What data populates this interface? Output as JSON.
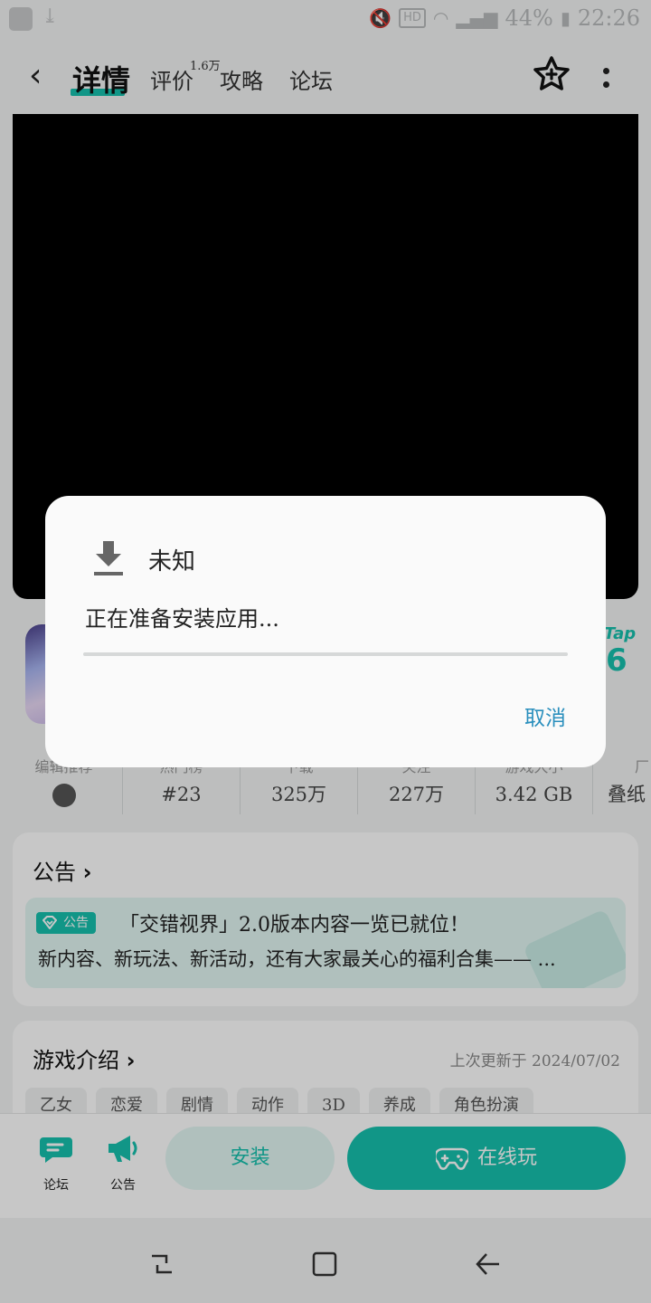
{
  "status_bar": {
    "download_icon": "download-arrow-icon",
    "hd_badge": "HD",
    "network": "4G",
    "battery": "44%",
    "time": "22:26"
  },
  "header": {
    "back_icon": "chevron-left-icon",
    "tabs": [
      {
        "label": "详情",
        "active": true
      },
      {
        "label": "评价",
        "badge": "1.6万"
      },
      {
        "label": "攻略"
      },
      {
        "label": "论坛"
      }
    ],
    "star_icon": "star-plus-icon",
    "more_icon": "more-vertical-icon"
  },
  "app": {
    "tap_label": "Tap",
    "tap_score": "6"
  },
  "stats": [
    {
      "label": "编辑推荐",
      "value": ""
    },
    {
      "label": "热门榜",
      "value": "#23"
    },
    {
      "label": "下载",
      "value": "325万"
    },
    {
      "label": "关注",
      "value": "227万"
    },
    {
      "label": "游戏大小",
      "value": "3.42 GB"
    },
    {
      "label": "厂",
      "value": "叠纸"
    }
  ],
  "announcement": {
    "title": "公告",
    "chevron": "›",
    "tag": "公告",
    "headline": "「交错视界」2.0版本内容一览已就位！",
    "body": "新内容、新玩法、新活动，还有大家最关心的福利合集—— ..."
  },
  "intro": {
    "title": "游戏介绍",
    "updated": "上次更新于 2024/07/02",
    "tags": [
      "乙女",
      "恋爱",
      "剧情",
      "动作",
      "3D",
      "养成",
      "角色扮演"
    ]
  },
  "bottom_bar": {
    "forum_label": "论坛",
    "notice_label": "公告",
    "install_label": "安装",
    "play_label": "在线玩"
  },
  "dialog": {
    "title": "未知",
    "message": "正在准备安装应用...",
    "cancel_label": "取消",
    "progress": 0
  },
  "colors": {
    "accent": "#16c1ad",
    "link": "#2a8fbd"
  }
}
